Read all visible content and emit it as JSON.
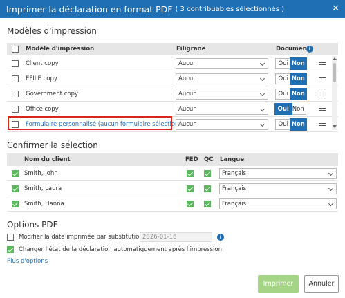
{
  "dialog": {
    "title": "Imprimer la déclaration en format PDF",
    "subtitle": "( 3 contribuables sélectionnés )",
    "close_icon": "close-icon"
  },
  "templates": {
    "section_title": "Modèles d'impression",
    "headers": {
      "model": "Modèle d'impression",
      "watermark": "Filigrane",
      "documents": "Documents"
    },
    "rows": [
      {
        "name": "Client copy",
        "watermark": "Aucun",
        "oui": "Oui",
        "non": "Non",
        "selected": "Non"
      },
      {
        "name": "EFILE copy",
        "watermark": "Aucun",
        "oui": "Oui",
        "non": "Non",
        "selected": "Non"
      },
      {
        "name": "Government copy",
        "watermark": "Aucun",
        "oui": "Oui",
        "non": "Non",
        "selected": "Non"
      },
      {
        "name": "Office copy",
        "watermark": "Aucun",
        "oui": "Oui",
        "non": "Non",
        "selected": "Oui"
      },
      {
        "name": "Formulaire personnalisé (aucun formulaire sélection",
        "watermark": "Aucun",
        "oui": "Oui",
        "non": "Non",
        "selected": "Non"
      }
    ]
  },
  "confirm": {
    "section_title": "Confirmer la sélection",
    "headers": {
      "client": "Nom du client",
      "fed": "FED",
      "qc": "QC",
      "language": "Langue"
    },
    "rows": [
      {
        "name": "Smith, John",
        "language": "Français"
      },
      {
        "name": "Smith, Laura",
        "language": "Français"
      },
      {
        "name": "Smith, Hanna",
        "language": "Français"
      }
    ]
  },
  "options": {
    "section_title": "Options PDF",
    "modify_date_label": "Modifier la date imprimée par substitution",
    "date_value": "2026-01-16",
    "change_state_label": "Changer l'état de la déclaration automatiquement après l'impression",
    "more_options": "Plus d'options"
  },
  "buttons": {
    "print": "Imprimer",
    "cancel": "Annuler"
  },
  "colors": {
    "accent": "#1f6fb5",
    "check_green": "#5cb85c",
    "highlight_red": "#d9261c",
    "print_button": "#a6d486"
  }
}
